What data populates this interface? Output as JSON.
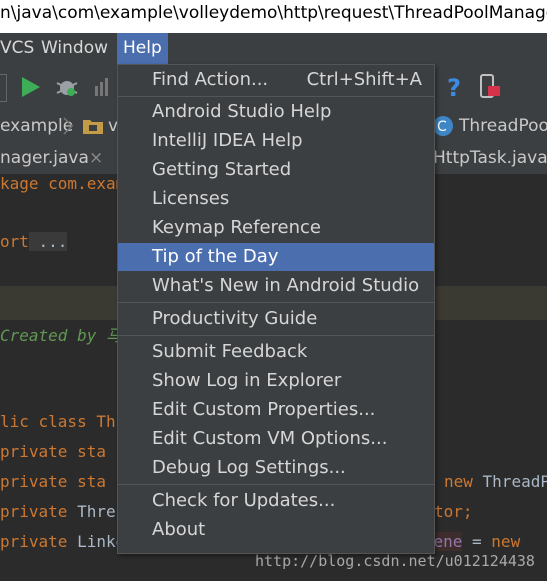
{
  "window": {
    "title": "n\\java\\com\\example\\volleydemo\\http\\request\\ThreadPoolManager"
  },
  "menubar": {
    "vcs": "VCS",
    "window": "Window",
    "help": "Help"
  },
  "breadcrumbs": {
    "example": "example",
    "v": "v",
    "threadpool": "ThreadPoo"
  },
  "tabs": {
    "left": "nager.java",
    "close": "×",
    "right": "HttpTask.java"
  },
  "editor": {
    "line1": "kage com.exam",
    "line2_kw": "ort",
    "line2_rest": " ...",
    "comment": "Created by",
    "comment_cn": "马",
    "line4": "lic class Thr",
    "line5_kw": "private",
    "line5_rest": " sta",
    "line6_kw": "private",
    "line6_rest": " sta",
    "line6_new": "new",
    "line6_end": " ThreadPo",
    "line7_kw": "private",
    "line7_rest": " Thre",
    "line7_end": "tor;",
    "line8_kw": "private",
    "line8_rest": " LinkedBlockingQueue<Future<?>> ",
    "line8_field": "taskQuene",
    "line8_eq": " = ",
    "line8_new": "new"
  },
  "watermark": "http://blog.csdn.net/u012124438",
  "help_menu": {
    "find_action": "Find Action...",
    "find_action_shortcut": "Ctrl+Shift+A",
    "android_studio_help": "Android Studio Help",
    "intellij_idea_help": "IntelliJ IDEA Help",
    "getting_started": "Getting Started",
    "licenses": "Licenses",
    "keymap_reference": "Keymap Reference",
    "tip_of_the_day": "Tip of the Day",
    "whats_new": "What's New in Android Studio",
    "productivity_guide": "Productivity Guide",
    "submit_feedback": "Submit Feedback",
    "show_log": "Show Log in Explorer",
    "edit_custom_properties": "Edit Custom Properties...",
    "edit_custom_vm": "Edit Custom VM Options...",
    "debug_log_settings": "Debug Log Settings...",
    "check_for_updates": "Check for Updates...",
    "about": "About"
  },
  "colors": {
    "menu_bg": "#3c3f41",
    "selected": "#4b6eaf",
    "keyword": "#cc7832",
    "comment": "#629755"
  },
  "icons": [
    "run-icon",
    "debug-icon",
    "profile-icon",
    "help-icon",
    "device-monitor-icon",
    "folder-icon",
    "class-icon"
  ]
}
